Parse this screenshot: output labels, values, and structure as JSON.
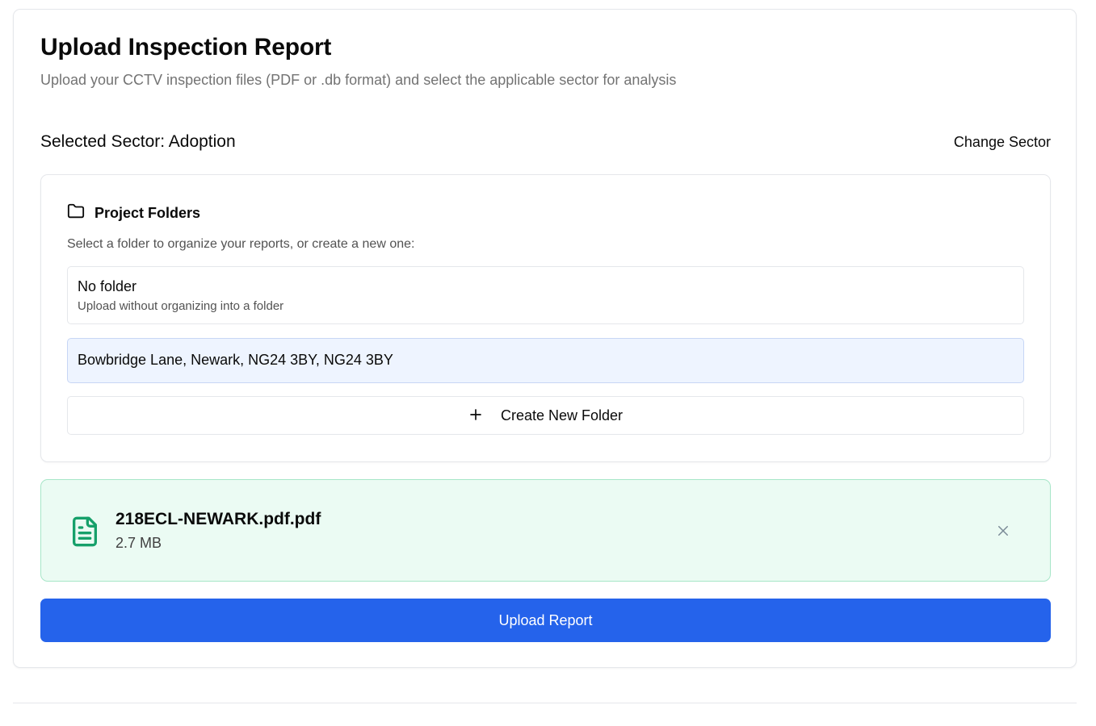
{
  "header": {
    "title": "Upload Inspection Report",
    "subtitle": "Upload your CCTV inspection files (PDF or .db format) and select the applicable sector for analysis"
  },
  "sector": {
    "selected_text": "Selected Sector: Adoption",
    "change_label": "Change Sector"
  },
  "folders": {
    "title": "Project Folders",
    "icon": "folder-icon",
    "hint": "Select a folder to organize your reports, or create a new one:",
    "no_folder": {
      "name": "No folder",
      "description": "Upload without organizing into a folder"
    },
    "items": [
      {
        "name": "Bowbridge Lane, Newark, NG24 3BY, NG24 3BY",
        "selected": true
      }
    ],
    "create_label": "Create New Folder",
    "create_icon": "plus-icon"
  },
  "file": {
    "name": "218ECL-NEWARK.pdf.pdf",
    "size": "2.7 MB",
    "icon": "file-text-icon",
    "remove_icon": "close-icon"
  },
  "upload": {
    "label": "Upload Report"
  },
  "colors": {
    "primary": "#2563eb",
    "file_accent": "#16a06a",
    "file_bg": "#ebfbf3",
    "selected_folder_bg": "#eef4ff",
    "muted_text": "#737373"
  }
}
